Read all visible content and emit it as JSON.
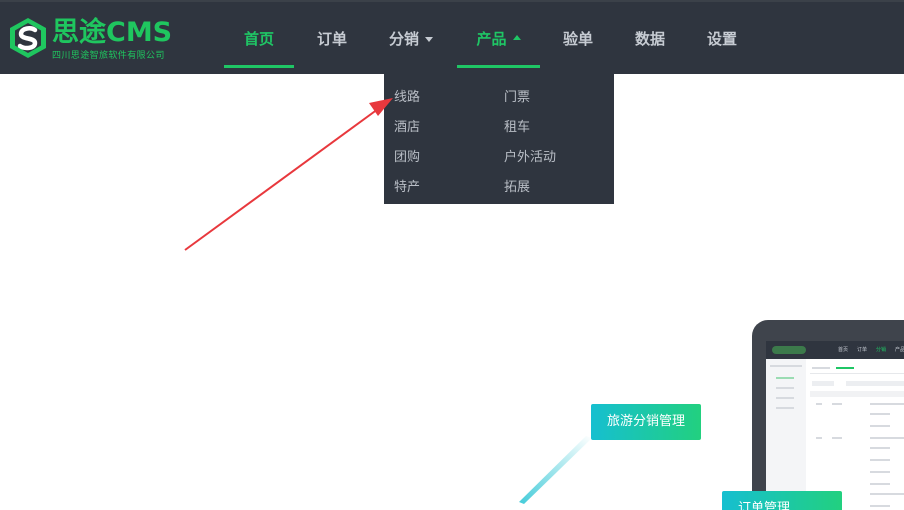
{
  "brand": {
    "name": "思途CMS",
    "subtitle": "四川思途智旅软件有限公司"
  },
  "nav": {
    "items": [
      {
        "label": "首页",
        "active": true
      },
      {
        "label": "订单",
        "active": false
      },
      {
        "label": "分销",
        "active": false,
        "caret": "down"
      },
      {
        "label": "产品",
        "active": true,
        "caret": "up"
      },
      {
        "label": "验单",
        "active": false
      },
      {
        "label": "数据",
        "active": false
      },
      {
        "label": "设置",
        "active": false
      }
    ]
  },
  "product_menu": {
    "left": [
      "线路",
      "酒店",
      "团购",
      "特产"
    ],
    "right": [
      "门票",
      "租车",
      "户外活动",
      "拓展"
    ]
  },
  "promo": {
    "badge_distribution": "旅游分销管理",
    "badge_order": "订单管理"
  },
  "mini_screen": {
    "nav": [
      "首页",
      "订单",
      "分销",
      "产品"
    ]
  },
  "colors": {
    "topbar": "#2f353f",
    "accent": "#1fc665",
    "arrow": "#e8383d"
  }
}
